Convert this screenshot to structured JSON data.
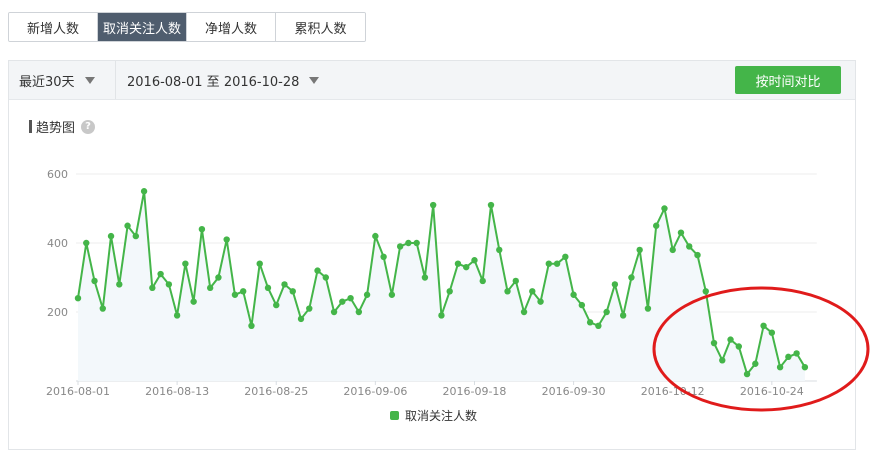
{
  "tabs": [
    {
      "label": "新增人数",
      "active": false
    },
    {
      "label": "取消关注人数",
      "active": true
    },
    {
      "label": "净增人数",
      "active": false
    },
    {
      "label": "累积人数",
      "active": false
    }
  ],
  "toolbar": {
    "range_select": "最近30天",
    "date_range": "2016-08-01 至 2016-10-28",
    "compare_button": "按时间对比"
  },
  "trend": {
    "title": "趋势图",
    "help_icon": "question-circle-icon"
  },
  "colors": {
    "series": "#44b549",
    "area": "#f3f8fb",
    "annotation": "#e01b1b",
    "active_tab": "#4f5d6e"
  },
  "chart_data": {
    "type": "line",
    "x_start": "2016-08-01",
    "x_end": "2016-10-28",
    "x_ticks": [
      "2016-08-01",
      "2016-08-13",
      "2016-08-25",
      "2016-09-06",
      "2016-09-18",
      "2016-09-30",
      "2016-10-12",
      "2016-10-24"
    ],
    "y_ticks": [
      200,
      400,
      600
    ],
    "ylim": [
      0,
      600
    ],
    "grid": true,
    "legend_position": "bottom-center",
    "series": [
      {
        "name": "取消关注人数",
        "values": [
          240,
          400,
          290,
          210,
          420,
          280,
          450,
          420,
          550,
          270,
          310,
          280,
          190,
          340,
          230,
          440,
          270,
          300,
          410,
          250,
          260,
          160,
          340,
          270,
          220,
          280,
          260,
          180,
          210,
          320,
          300,
          200,
          230,
          240,
          200,
          250,
          420,
          360,
          250,
          390,
          400,
          400,
          300,
          510,
          190,
          260,
          340,
          330,
          350,
          290,
          510,
          380,
          260,
          290,
          200,
          260,
          230,
          340,
          340,
          360,
          250,
          220,
          170,
          160,
          200,
          280,
          190,
          300,
          380,
          210,
          450,
          500,
          380,
          430,
          390,
          365,
          260,
          110,
          60,
          120,
          100,
          20,
          50,
          160,
          140,
          40,
          70,
          80,
          40
        ]
      }
    ],
    "annotation": "red-ellipse-highlight"
  }
}
